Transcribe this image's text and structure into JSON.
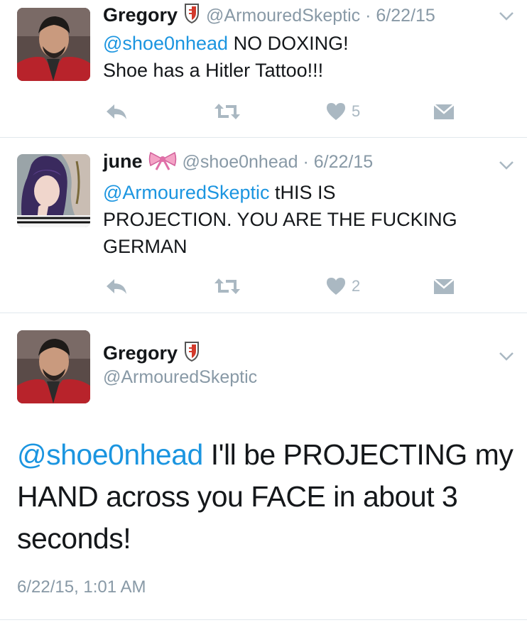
{
  "tweets": [
    {
      "name": "Gregory",
      "handle": "@ArmouredSkeptic",
      "date": "6/22/15",
      "mention": "@shoe0nhead",
      "text_line1": " NO DOXING!",
      "text_line2": "Shoe has a Hitler Tattoo!!!",
      "likes": "5",
      "badge": "shield-icon"
    },
    {
      "name": "june",
      "handle": "@shoe0nhead",
      "date": "6/22/15",
      "mention": "@ArmouredSkeptic",
      "text_line1": " tHIS IS",
      "text_line2": "PROJECTION. YOU ARE THE FUCKING",
      "text_line3": "GERMAN",
      "likes": "2",
      "badge": "bow-icon"
    }
  ],
  "focused": {
    "name": "Gregory",
    "handle": "@ArmouredSkeptic",
    "mention": "@shoe0nhead",
    "text_line1": " I'll be PROJECTING my",
    "text_line2": "HAND across you FACE in about 3",
    "text_line3": "seconds!",
    "timestamp": "6/22/15, 1:01 AM",
    "badge": "shield-icon"
  },
  "colors": {
    "link": "#1b95e0",
    "muted": "#8899a6",
    "icon": "#aab8c2",
    "divider": "#e1e8ed"
  }
}
